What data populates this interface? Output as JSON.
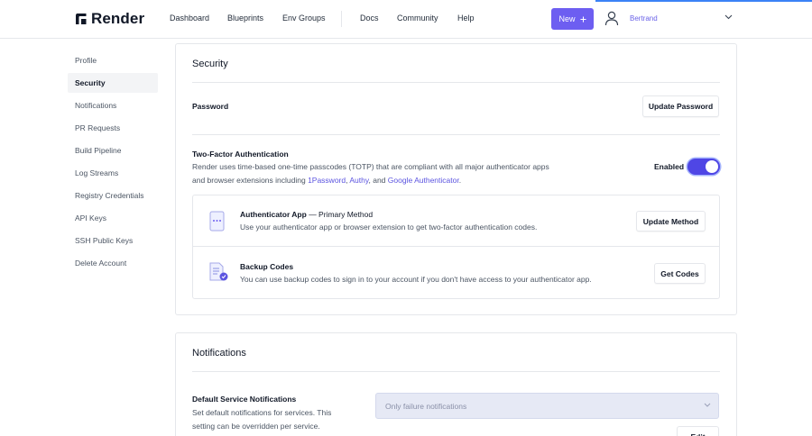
{
  "brand": {
    "name": "Render",
    "accent": "#6d5ef1"
  },
  "nav": {
    "items": [
      "Dashboard",
      "Blueprints",
      "Env Groups",
      "Docs",
      "Community",
      "Help"
    ],
    "new_label": "New",
    "user_name": "Bertrand"
  },
  "sidebar": {
    "active": "Security",
    "items": [
      {
        "label": "Profile"
      },
      {
        "label": "Security"
      },
      {
        "label": "Notifications"
      },
      {
        "label": "PR Requests"
      },
      {
        "label": "Build Pipeline"
      },
      {
        "label": "Log Streams"
      },
      {
        "label": "Registry Credentials"
      },
      {
        "label": "API Keys"
      },
      {
        "label": "SSH Public Keys"
      },
      {
        "label": "Delete Account"
      }
    ]
  },
  "security": {
    "title": "Security",
    "password": {
      "label": "Password",
      "button": "Update Password"
    },
    "two_factor": {
      "title": "Two-Factor Authentication",
      "desc_1": "Render uses time-based one-time passcodes (TOTP) that are compliant with all major authenticator apps",
      "desc_2a": "and browser extensions including ",
      "link_1password": "1Password",
      "sep_1": ", ",
      "link_authy": "Authy",
      "sep_2": ", and ",
      "link_google": "Google Authenticator",
      "desc_end": ".",
      "status_label": "Enabled",
      "enabled": true
    },
    "methods": {
      "authenticator": {
        "title": "Authenticator App",
        "subtitle": " — Primary Method",
        "desc": "Use your authenticator app or browser extension to get two-factor authentication codes.",
        "button": "Update Method"
      },
      "backup": {
        "title": "Backup Codes",
        "desc": "You can use backup codes to sign in to your account if you don't have access to your authenticator app.",
        "button": "Get Codes"
      }
    }
  },
  "notifications": {
    "title": "Notifications",
    "default": {
      "title": "Default Service Notifications",
      "desc_1": "Set default notifications for services. This",
      "desc_2": "setting can be overridden per service.",
      "select_value": "Only failure notifications",
      "edit_button": "Edit"
    }
  }
}
